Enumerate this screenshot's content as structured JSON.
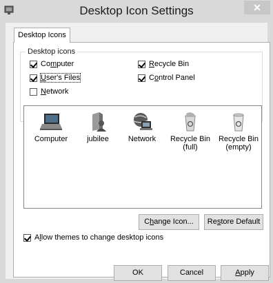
{
  "window": {
    "title": "Desktop Icon Settings",
    "close_glyph": "✕"
  },
  "tabs": [
    {
      "label": "Desktop Icons"
    }
  ],
  "group": {
    "label": "Desktop icons",
    "checkboxes": [
      {
        "pre": "Co",
        "mn": "m",
        "post": "puter",
        "checked": true
      },
      {
        "pre": "",
        "mn": "R",
        "post": "ecycle Bin",
        "checked": true
      },
      {
        "pre": "",
        "mn": "U",
        "post": "ser's Files",
        "checked": true
      },
      {
        "pre": "C",
        "mn": "o",
        "post": "ntrol Panel",
        "checked": true
      },
      {
        "pre": "",
        "mn": "N",
        "post": "etwork",
        "checked": false
      }
    ]
  },
  "icons": [
    {
      "label": "Computer",
      "icon": "computer-icon"
    },
    {
      "label": "jubilee",
      "icon": "user-files-icon"
    },
    {
      "label": "Network",
      "icon": "network-icon"
    },
    {
      "label": "Recycle Bin (full)",
      "icon": "recycle-bin-full-icon"
    },
    {
      "label": "Recycle Bin (empty)",
      "icon": "recycle-bin-empty-icon"
    }
  ],
  "buttons": {
    "change_icon": {
      "pre": "C",
      "mn": "h",
      "post": "ange Icon..."
    },
    "restore_default": {
      "pre": "Re",
      "mn": "s",
      "post": "tore Default"
    },
    "ok": "OK",
    "cancel": "Cancel",
    "apply": {
      "pre": "",
      "mn": "A",
      "post": "pply"
    }
  },
  "allow_themes": {
    "pre": "A",
    "mn": "l",
    "post": "low themes to change desktop icons",
    "checked": true
  }
}
